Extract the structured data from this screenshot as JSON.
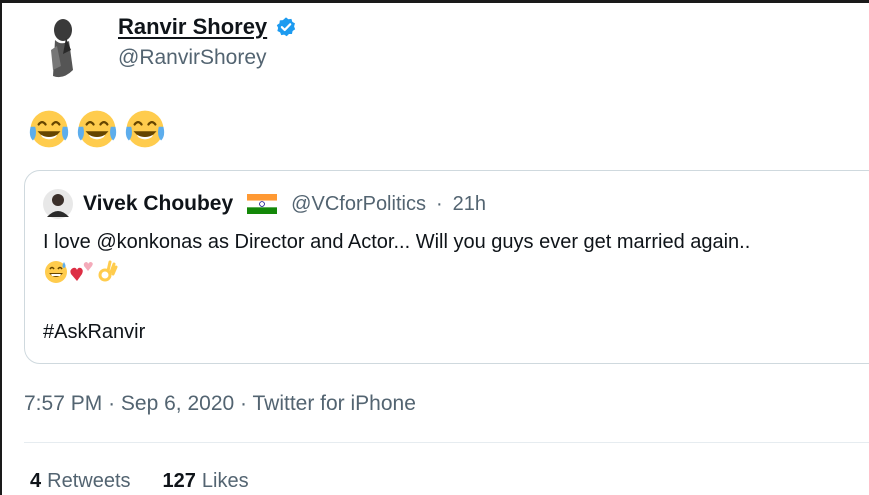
{
  "author": {
    "display_name": "Ranvir Shorey",
    "handle": "@RanvirShorey",
    "verified_icon": "verified-badge-icon"
  },
  "tweet": {
    "emojis": [
      "face-with-tears-of-joy",
      "face-with-tears-of-joy",
      "face-with-tears-of-joy"
    ]
  },
  "quoted": {
    "display_name": "Vivek Choubey",
    "flag_icon": "india-flag-icon",
    "handle": "@VCforPolitics",
    "separator": "·",
    "time": "21h",
    "text": "I love @konkonas as Director and Actor... Will you guys ever get married again..",
    "emojis": [
      "grinning-face-with-sweat",
      "two-hearts",
      "ok-hand"
    ],
    "hashtag": "#AskRanvir"
  },
  "meta": {
    "time": "7:57 PM",
    "sep1": "·",
    "date": "Sep 6, 2020",
    "sep2": "·",
    "source": "Twitter for iPhone"
  },
  "stats": {
    "retweets_count": "4",
    "retweets_label": "Retweets",
    "likes_count": "127",
    "likes_label": "Likes"
  },
  "colors": {
    "text_primary": "#0f1419",
    "text_secondary": "#536471",
    "verified_blue": "#1d9bf0",
    "border": "#cfd9de"
  }
}
